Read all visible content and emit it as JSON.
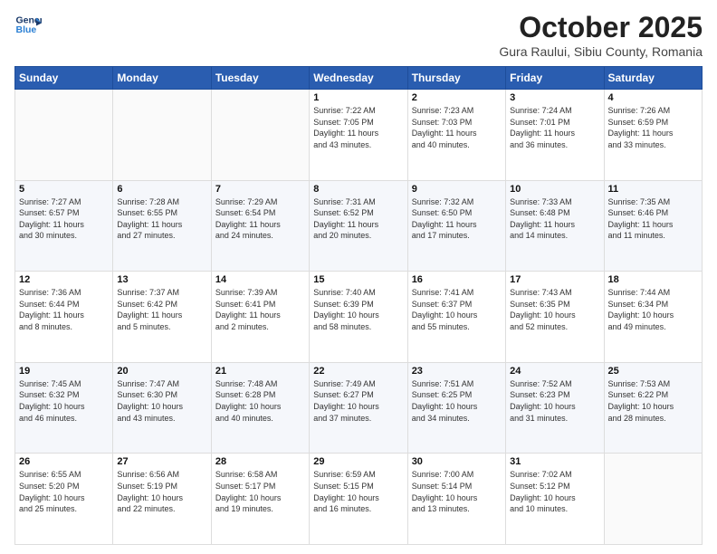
{
  "header": {
    "logo_line1": "General",
    "logo_line2": "Blue",
    "title": "October 2025",
    "subtitle": "Gura Raului, Sibiu County, Romania"
  },
  "weekdays": [
    "Sunday",
    "Monday",
    "Tuesday",
    "Wednesday",
    "Thursday",
    "Friday",
    "Saturday"
  ],
  "weeks": [
    [
      {
        "day": "",
        "info": ""
      },
      {
        "day": "",
        "info": ""
      },
      {
        "day": "",
        "info": ""
      },
      {
        "day": "1",
        "info": "Sunrise: 7:22 AM\nSunset: 7:05 PM\nDaylight: 11 hours\nand 43 minutes."
      },
      {
        "day": "2",
        "info": "Sunrise: 7:23 AM\nSunset: 7:03 PM\nDaylight: 11 hours\nand 40 minutes."
      },
      {
        "day": "3",
        "info": "Sunrise: 7:24 AM\nSunset: 7:01 PM\nDaylight: 11 hours\nand 36 minutes."
      },
      {
        "day": "4",
        "info": "Sunrise: 7:26 AM\nSunset: 6:59 PM\nDaylight: 11 hours\nand 33 minutes."
      }
    ],
    [
      {
        "day": "5",
        "info": "Sunrise: 7:27 AM\nSunset: 6:57 PM\nDaylight: 11 hours\nand 30 minutes."
      },
      {
        "day": "6",
        "info": "Sunrise: 7:28 AM\nSunset: 6:55 PM\nDaylight: 11 hours\nand 27 minutes."
      },
      {
        "day": "7",
        "info": "Sunrise: 7:29 AM\nSunset: 6:54 PM\nDaylight: 11 hours\nand 24 minutes."
      },
      {
        "day": "8",
        "info": "Sunrise: 7:31 AM\nSunset: 6:52 PM\nDaylight: 11 hours\nand 20 minutes."
      },
      {
        "day": "9",
        "info": "Sunrise: 7:32 AM\nSunset: 6:50 PM\nDaylight: 11 hours\nand 17 minutes."
      },
      {
        "day": "10",
        "info": "Sunrise: 7:33 AM\nSunset: 6:48 PM\nDaylight: 11 hours\nand 14 minutes."
      },
      {
        "day": "11",
        "info": "Sunrise: 7:35 AM\nSunset: 6:46 PM\nDaylight: 11 hours\nand 11 minutes."
      }
    ],
    [
      {
        "day": "12",
        "info": "Sunrise: 7:36 AM\nSunset: 6:44 PM\nDaylight: 11 hours\nand 8 minutes."
      },
      {
        "day": "13",
        "info": "Sunrise: 7:37 AM\nSunset: 6:42 PM\nDaylight: 11 hours\nand 5 minutes."
      },
      {
        "day": "14",
        "info": "Sunrise: 7:39 AM\nSunset: 6:41 PM\nDaylight: 11 hours\nand 2 minutes."
      },
      {
        "day": "15",
        "info": "Sunrise: 7:40 AM\nSunset: 6:39 PM\nDaylight: 10 hours\nand 58 minutes."
      },
      {
        "day": "16",
        "info": "Sunrise: 7:41 AM\nSunset: 6:37 PM\nDaylight: 10 hours\nand 55 minutes."
      },
      {
        "day": "17",
        "info": "Sunrise: 7:43 AM\nSunset: 6:35 PM\nDaylight: 10 hours\nand 52 minutes."
      },
      {
        "day": "18",
        "info": "Sunrise: 7:44 AM\nSunset: 6:34 PM\nDaylight: 10 hours\nand 49 minutes."
      }
    ],
    [
      {
        "day": "19",
        "info": "Sunrise: 7:45 AM\nSunset: 6:32 PM\nDaylight: 10 hours\nand 46 minutes."
      },
      {
        "day": "20",
        "info": "Sunrise: 7:47 AM\nSunset: 6:30 PM\nDaylight: 10 hours\nand 43 minutes."
      },
      {
        "day": "21",
        "info": "Sunrise: 7:48 AM\nSunset: 6:28 PM\nDaylight: 10 hours\nand 40 minutes."
      },
      {
        "day": "22",
        "info": "Sunrise: 7:49 AM\nSunset: 6:27 PM\nDaylight: 10 hours\nand 37 minutes."
      },
      {
        "day": "23",
        "info": "Sunrise: 7:51 AM\nSunset: 6:25 PM\nDaylight: 10 hours\nand 34 minutes."
      },
      {
        "day": "24",
        "info": "Sunrise: 7:52 AM\nSunset: 6:23 PM\nDaylight: 10 hours\nand 31 minutes."
      },
      {
        "day": "25",
        "info": "Sunrise: 7:53 AM\nSunset: 6:22 PM\nDaylight: 10 hours\nand 28 minutes."
      }
    ],
    [
      {
        "day": "26",
        "info": "Sunrise: 6:55 AM\nSunset: 5:20 PM\nDaylight: 10 hours\nand 25 minutes."
      },
      {
        "day": "27",
        "info": "Sunrise: 6:56 AM\nSunset: 5:19 PM\nDaylight: 10 hours\nand 22 minutes."
      },
      {
        "day": "28",
        "info": "Sunrise: 6:58 AM\nSunset: 5:17 PM\nDaylight: 10 hours\nand 19 minutes."
      },
      {
        "day": "29",
        "info": "Sunrise: 6:59 AM\nSunset: 5:15 PM\nDaylight: 10 hours\nand 16 minutes."
      },
      {
        "day": "30",
        "info": "Sunrise: 7:00 AM\nSunset: 5:14 PM\nDaylight: 10 hours\nand 13 minutes."
      },
      {
        "day": "31",
        "info": "Sunrise: 7:02 AM\nSunset: 5:12 PM\nDaylight: 10 hours\nand 10 minutes."
      },
      {
        "day": "",
        "info": ""
      }
    ]
  ]
}
